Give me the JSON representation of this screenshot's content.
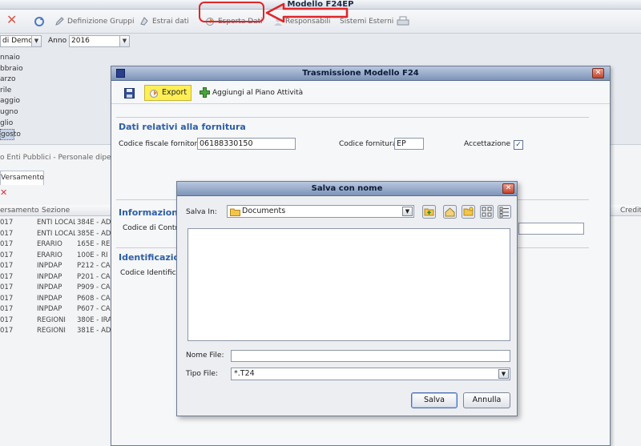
{
  "app": {
    "title": "Modello F24EP",
    "toolbar": {
      "definizione_gruppi": "Definizione Gruppi",
      "estrai_dati": "Estrai dati",
      "esporta_dati": "Esporta Dati",
      "responsabili": "Responsabili",
      "sistemi_esterni": "Sistemi Esterni"
    },
    "filters": {
      "ente_value": "di Demo",
      "anno_label": "Anno",
      "anno_value": "2016"
    },
    "months": [
      "nnaio",
      "bbraio",
      "arzo",
      "rile",
      "aggio",
      "ugno",
      "glio",
      "gosto"
    ],
    "entity_label": "o Enti Pubblici - Personale dipende",
    "tab_label": "Versamento",
    "grid": {
      "columns": [
        "ersamento",
        "Sezione",
        "Credit"
      ],
      "rows": [
        {
          "anno": "017",
          "sezione": "ENTI LOCALI",
          "tributo": "384E - AD"
        },
        {
          "anno": "017",
          "sezione": "ENTI LOCALI",
          "tributo": "385E - AD"
        },
        {
          "anno": "017",
          "sezione": "ERARIO",
          "tributo": "165E - RE"
        },
        {
          "anno": "017",
          "sezione": "ERARIO",
          "tributo": "100E - RI"
        },
        {
          "anno": "017",
          "sezione": "INPDAP",
          "tributo": "P212 - CA"
        },
        {
          "anno": "017",
          "sezione": "INPDAP",
          "tributo": "P201 - CA"
        },
        {
          "anno": "017",
          "sezione": "INPDAP",
          "tributo": "P909 - CA"
        },
        {
          "anno": "017",
          "sezione": "INPDAP",
          "tributo": "P608 - CA"
        },
        {
          "anno": "017",
          "sezione": "INPDAP",
          "tributo": "P607 - CA"
        },
        {
          "anno": "017",
          "sezione": "REGIONI",
          "tributo": "380E - IRA"
        },
        {
          "anno": "017",
          "sezione": "REGIONI",
          "tributo": "381E - AD"
        }
      ]
    }
  },
  "trasmissione": {
    "title": "Trasmissione Modello F24",
    "close": "✕",
    "toolbar": {
      "export_label": "Export",
      "piano_label": "Aggiungi al Piano Attività"
    },
    "fornitura": {
      "title": "Dati relativi alla fornitura",
      "codice_fiscale_label": "Codice fiscale fornitore",
      "codice_fiscale_value": "06188330150",
      "codice_fornitura_label": "Codice fornitura",
      "codice_fornitura_value": "EP",
      "accettazione_label": "Accettazione",
      "accettazione_check": "✓"
    },
    "informazioni": {
      "title": "Informazioni",
      "codice_controllo_label": "Codice di Contro"
    },
    "identificazione": {
      "title": "Identificazion",
      "codice_identificativo_label": "Codice Identificati"
    }
  },
  "salva_dialog": {
    "title": "Salva con nome",
    "close": "✕",
    "salva_in_label": "Salva In:",
    "salva_in_value": "Documents",
    "nome_file_label": "Nome File:",
    "nome_file_value": "",
    "tipo_file_label": "Tipo File:",
    "tipo_file_value": "*.T24",
    "salva_button": "Salva",
    "annulla_button": "Annulla"
  }
}
